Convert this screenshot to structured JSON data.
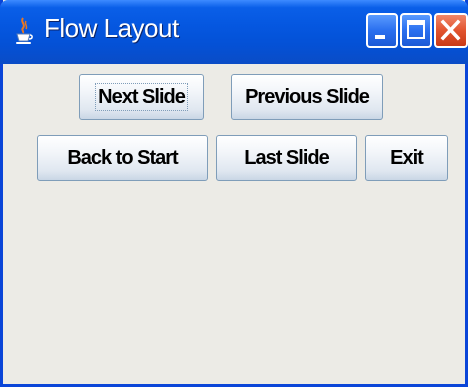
{
  "window": {
    "title": "Flow Layout",
    "icon": "java-cup-icon",
    "controls": {
      "minimize_icon": "minimize-icon",
      "maximize_icon": "maximize-icon",
      "close_icon": "close-icon"
    }
  },
  "buttons": {
    "next_slide": "Next Slide",
    "previous_slide": "Previous Slide",
    "back_to_start": "Back to Start",
    "last_slide": "Last Slide",
    "exit": "Exit"
  },
  "colors": {
    "titlebar": "#0557e0",
    "close_button": "#e2542e",
    "content_background": "#ecebe6",
    "button_border": "#7f9db9"
  }
}
